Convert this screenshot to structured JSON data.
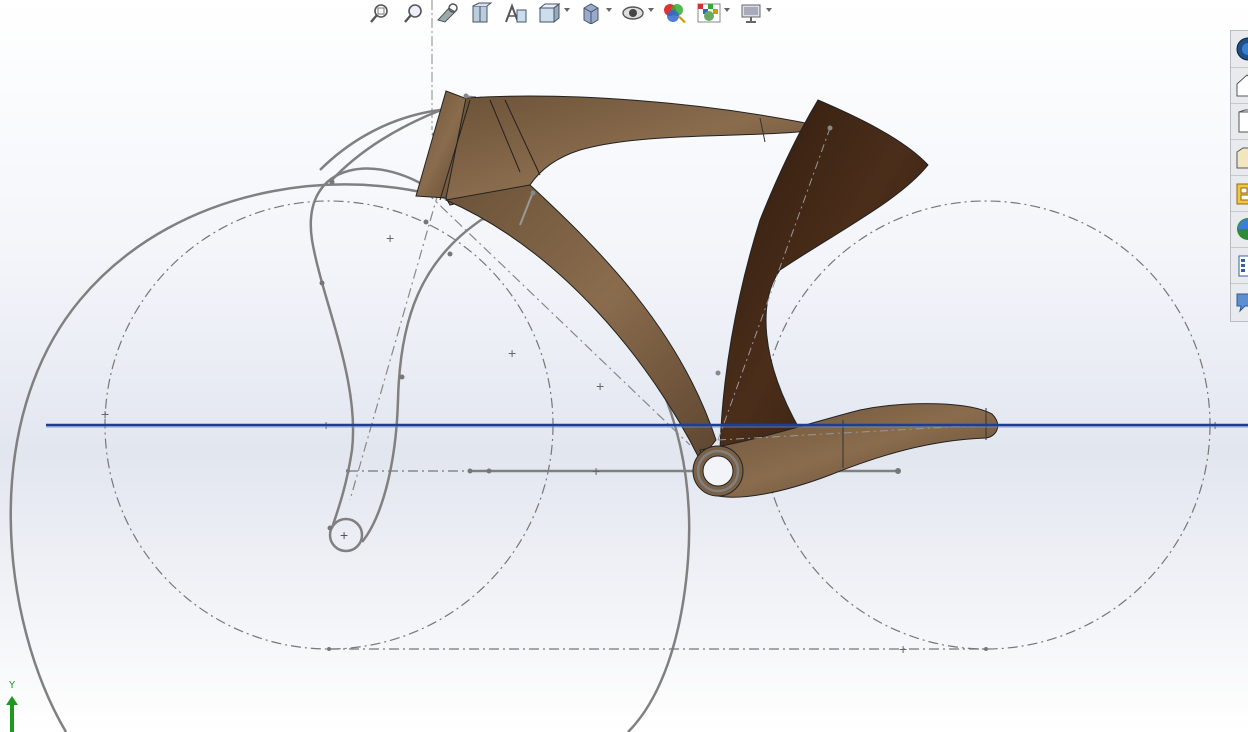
{
  "toolbar": {
    "buttons": [
      {
        "name": "zoom-to-fit-icon",
        "dropdown": false
      },
      {
        "name": "zoom-to-area-icon",
        "dropdown": false
      },
      {
        "name": "previous-view-icon",
        "dropdown": false
      },
      {
        "name": "section-view-icon",
        "dropdown": false
      },
      {
        "name": "dynamic-annotation-views-icon",
        "dropdown": false
      },
      {
        "name": "view-orientation-icon",
        "dropdown": true
      },
      {
        "name": "display-style-icon",
        "dropdown": true
      },
      {
        "name": "hide-show-items-icon",
        "dropdown": true
      },
      {
        "name": "edit-appearance-icon",
        "dropdown": false
      },
      {
        "name": "apply-scene-icon",
        "dropdown": true
      },
      {
        "name": "view-settings-icon",
        "dropdown": true
      }
    ]
  },
  "task_pane": {
    "tabs": [
      {
        "name": "solidworks-resources-icon"
      },
      {
        "name": "design-library-icon"
      },
      {
        "name": "file-explorer-icon"
      },
      {
        "name": "view-palette-icon"
      },
      {
        "name": "appearances-scenes-icon"
      },
      {
        "name": "custom-properties-icon"
      },
      {
        "name": "solidworks-forum-icon"
      },
      {
        "name": "feedback-icon"
      }
    ]
  },
  "triad": {
    "axis_label": "Y"
  },
  "colors": {
    "frame_light": "#7a6045",
    "frame_dark": "#3c2414",
    "sketch_gray": "#7d7d7d",
    "ground_line": "#1f3f8c",
    "triad_green": "#1d9a1d"
  }
}
